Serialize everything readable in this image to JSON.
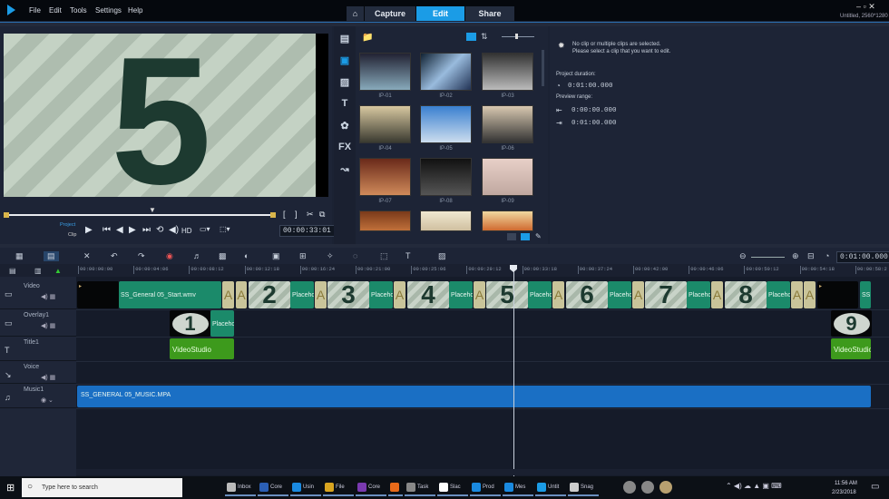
{
  "app": {
    "title": "Untitled, 2560*1280",
    "menu": [
      "File",
      "Edit",
      "Tools",
      "Settings",
      "Help"
    ],
    "tabs": [
      {
        "label": "Capture"
      },
      {
        "label": "Edit"
      },
      {
        "label": "Share"
      }
    ],
    "active_tab": "Edit",
    "accent": "#1b9ce6"
  },
  "preview": {
    "frame_number": "5",
    "project_label": "Project",
    "clip_label": "Clip",
    "hd_label": "HD",
    "timecode": "00:00:33:01"
  },
  "library": {
    "items": [
      "IP-01",
      "IP-02",
      "IP-03",
      "IP-04",
      "IP-05",
      "IP-06",
      "IP-07",
      "IP-08",
      "IP-09",
      "",
      "",
      ""
    ],
    "side_icons": [
      "media-icon",
      "instant-project-icon",
      "transition-icon",
      "title-icon",
      "graphics-icon",
      "FX",
      "path-icon"
    ]
  },
  "options": {
    "message1": "No clip or multiple clips are selected.",
    "message2": "Please select a clip that you want to edit.",
    "duration_label": "Project duration:",
    "duration": "0:01:00.000",
    "range_label": "Preview range:",
    "range_in": "0:00:00.000",
    "range_out": "0:01:00.000"
  },
  "timeline": {
    "zoom_timecode": "0:01:00.000",
    "ruler": [
      "00:00:00:00",
      "00:00:04:06",
      "00:00:08:12",
      "00:00:12:18",
      "00:00:16:24",
      "00:00:21:00",
      "00:00:25:06",
      "00:00:29:12",
      "00:00:33:18",
      "00:00:37:24",
      "00:00:42:00",
      "00:00:46:06",
      "00:00:50:12",
      "00:00:54:18",
      "00:00:58:2"
    ],
    "tracks": [
      "Video",
      "Overlay1",
      "Title1",
      "Voice",
      "Music1"
    ],
    "clips": {
      "start": "SS_General 05_Start.wmv",
      "placeholder": "Placeholder",
      "end": "SS",
      "title": "VideoStudio",
      "music": "SS_GENERAL 05_MUSIC.MPA",
      "numbers": [
        "1",
        "2",
        "3",
        "4",
        "5",
        "6",
        "7",
        "8",
        "9"
      ]
    }
  },
  "taskbar": {
    "search_placeholder": "Type here to search",
    "apps": [
      "Inbox",
      "Core",
      "Usin",
      "File",
      "Core",
      "",
      "Task",
      "Slac",
      "Prod",
      "Mes",
      "Untit",
      "Snag"
    ],
    "time": "11:56 AM",
    "date": "2/23/2018"
  }
}
